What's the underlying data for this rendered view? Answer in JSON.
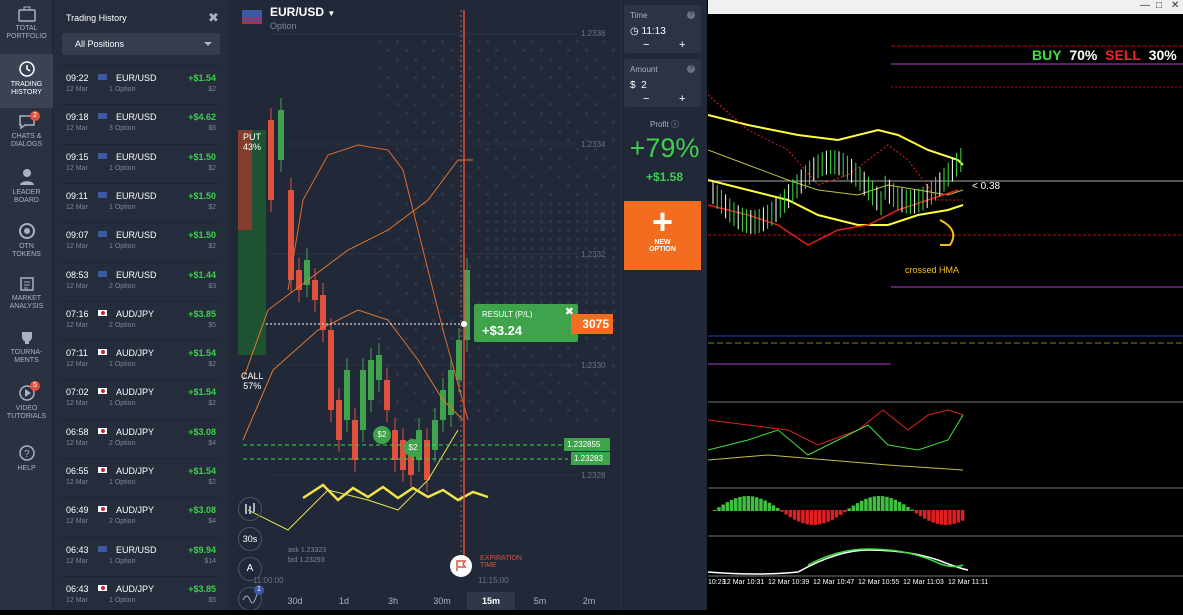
{
  "sidebar": {
    "items": [
      {
        "label1": "TOTAL",
        "label2": "PORTFOLIO"
      },
      {
        "label1": "TRADING",
        "label2": "HISTORY"
      },
      {
        "label1": "CHATS &",
        "label2": "DIALOGS",
        "badge": "2"
      },
      {
        "label1": "LEADER",
        "label2": "BOARD"
      },
      {
        "label1": "OTN",
        "label2": "TOKENS"
      },
      {
        "label1": "MARKET",
        "label2": "ANALYSIS"
      },
      {
        "label1": "TOURNA-",
        "label2": "MENTS"
      },
      {
        "label1": "VIDEO",
        "label2": "TUTORIALS",
        "badge": "5"
      },
      {
        "label1": "HELP",
        "label2": ""
      }
    ]
  },
  "history": {
    "title": "Trading History",
    "close": "✖",
    "filter": "All Positions",
    "rows": [
      {
        "time": "09:22",
        "date": "12 Mar",
        "pair": "EUR/USD",
        "opt": "1 Option",
        "profit": "+$1.54",
        "invest": "$2",
        "flag": "us"
      },
      {
        "time": "09:18",
        "date": "12 Mar",
        "pair": "EUR/USD",
        "opt": "3 Option",
        "profit": "+$4.62",
        "invest": "$6",
        "flag": "us"
      },
      {
        "time": "09:15",
        "date": "12 Mar",
        "pair": "EUR/USD",
        "opt": "1 Option",
        "profit": "+$1.50",
        "invest": "$2",
        "flag": "us"
      },
      {
        "time": "09:11",
        "date": "12 Mar",
        "pair": "EUR/USD",
        "opt": "1 Option",
        "profit": "+$1.50",
        "invest": "$2",
        "flag": "us"
      },
      {
        "time": "09:07",
        "date": "12 Mar",
        "pair": "EUR/USD",
        "opt": "1 Option",
        "profit": "+$1.50",
        "invest": "$2",
        "flag": "us"
      },
      {
        "time": "08:53",
        "date": "12 Mar",
        "pair": "EUR/USD",
        "opt": "2 Option",
        "profit": "+$1.44",
        "invest": "$3",
        "flag": "us"
      },
      {
        "time": "07:16",
        "date": "12 Mar",
        "pair": "AUD/JPY",
        "opt": "2 Option",
        "profit": "+$3.85",
        "invest": "$5",
        "flag": "jp"
      },
      {
        "time": "07:11",
        "date": "12 Mar",
        "pair": "AUD/JPY",
        "opt": "1 Option",
        "profit": "+$1.54",
        "invest": "$2",
        "flag": "jp"
      },
      {
        "time": "07:02",
        "date": "12 Mar",
        "pair": "AUD/JPY",
        "opt": "1 Option",
        "profit": "+$1.54",
        "invest": "$2",
        "flag": "jp"
      },
      {
        "time": "06:58",
        "date": "12 Mar",
        "pair": "AUD/JPY",
        "opt": "2 Option",
        "profit": "+$3.08",
        "invest": "$4",
        "flag": "jp"
      },
      {
        "time": "06:55",
        "date": "12 Mar",
        "pair": "AUD/JPY",
        "opt": "1 Option",
        "profit": "+$1.54",
        "invest": "$2",
        "flag": "jp"
      },
      {
        "time": "06:49",
        "date": "12 Mar",
        "pair": "AUD/JPY",
        "opt": "2 Option",
        "profit": "+$3.08",
        "invest": "$4",
        "flag": "jp"
      },
      {
        "time": "06:43",
        "date": "12 Mar",
        "pair": "EUR/USD",
        "opt": "1 Option",
        "profit": "+$9.94",
        "invest": "$14",
        "flag": "us"
      },
      {
        "time": "06:43",
        "date": "12 Mar",
        "pair": "AUD/JPY",
        "opt": "1 Option",
        "profit": "+$3.85",
        "invest": "$5",
        "flag": "jp"
      }
    ]
  },
  "chart": {
    "asset": "EUR/USD",
    "asset_sub": "Option",
    "put_label": "PUT",
    "put_pct": "43%",
    "call_label": "CALL",
    "call_pct": "57%",
    "prices": [
      "1.2336",
      "1.2334",
      "1.2332",
      "1.2330",
      "1.2328"
    ],
    "result_label": "RESULT (P/L)",
    "result_value": "+$3.24",
    "current_price_tail": "3075",
    "level1": "1.232855",
    "level2": "1.23283",
    "bubble1": "$2",
    "bubble2": "$2",
    "ask": "ask 1.23323",
    "bid": "bid 1.23293",
    "expiration": "EXPIRATION",
    "expiration2": "TIME",
    "time_left": "11:00:00",
    "time_right": "11:15:00",
    "tool_30s": "30s",
    "tool_badge": "1",
    "timeframes": [
      "30d",
      "1d",
      "3h",
      "30m",
      "15m",
      "5m",
      "2m"
    ],
    "active_tf": "15m"
  },
  "panel": {
    "time_label": "Time",
    "time_value": "11:13",
    "amount_label": "Amount",
    "amount_currency": "$",
    "amount_value": "2",
    "profit_label": "Profit",
    "profit_pct": "+79%",
    "profit_value": "+$1.58",
    "new_option1": "NEW",
    "new_option2": "OPTION"
  },
  "mt4": {
    "buy_label": "BUY",
    "buy_pct": "70%",
    "sell_label": "SELL",
    "sell_pct": "30%",
    "ratio": "< 0.38",
    "annotation": "crossed HMA",
    "time_labels": [
      "10:23",
      "12 Mar 10:31",
      "12 Mar 10:39",
      "12 Mar 10:47",
      "12 Mar 10:55",
      "12 Mar 11:03",
      "12 Mar 11:11"
    ]
  }
}
